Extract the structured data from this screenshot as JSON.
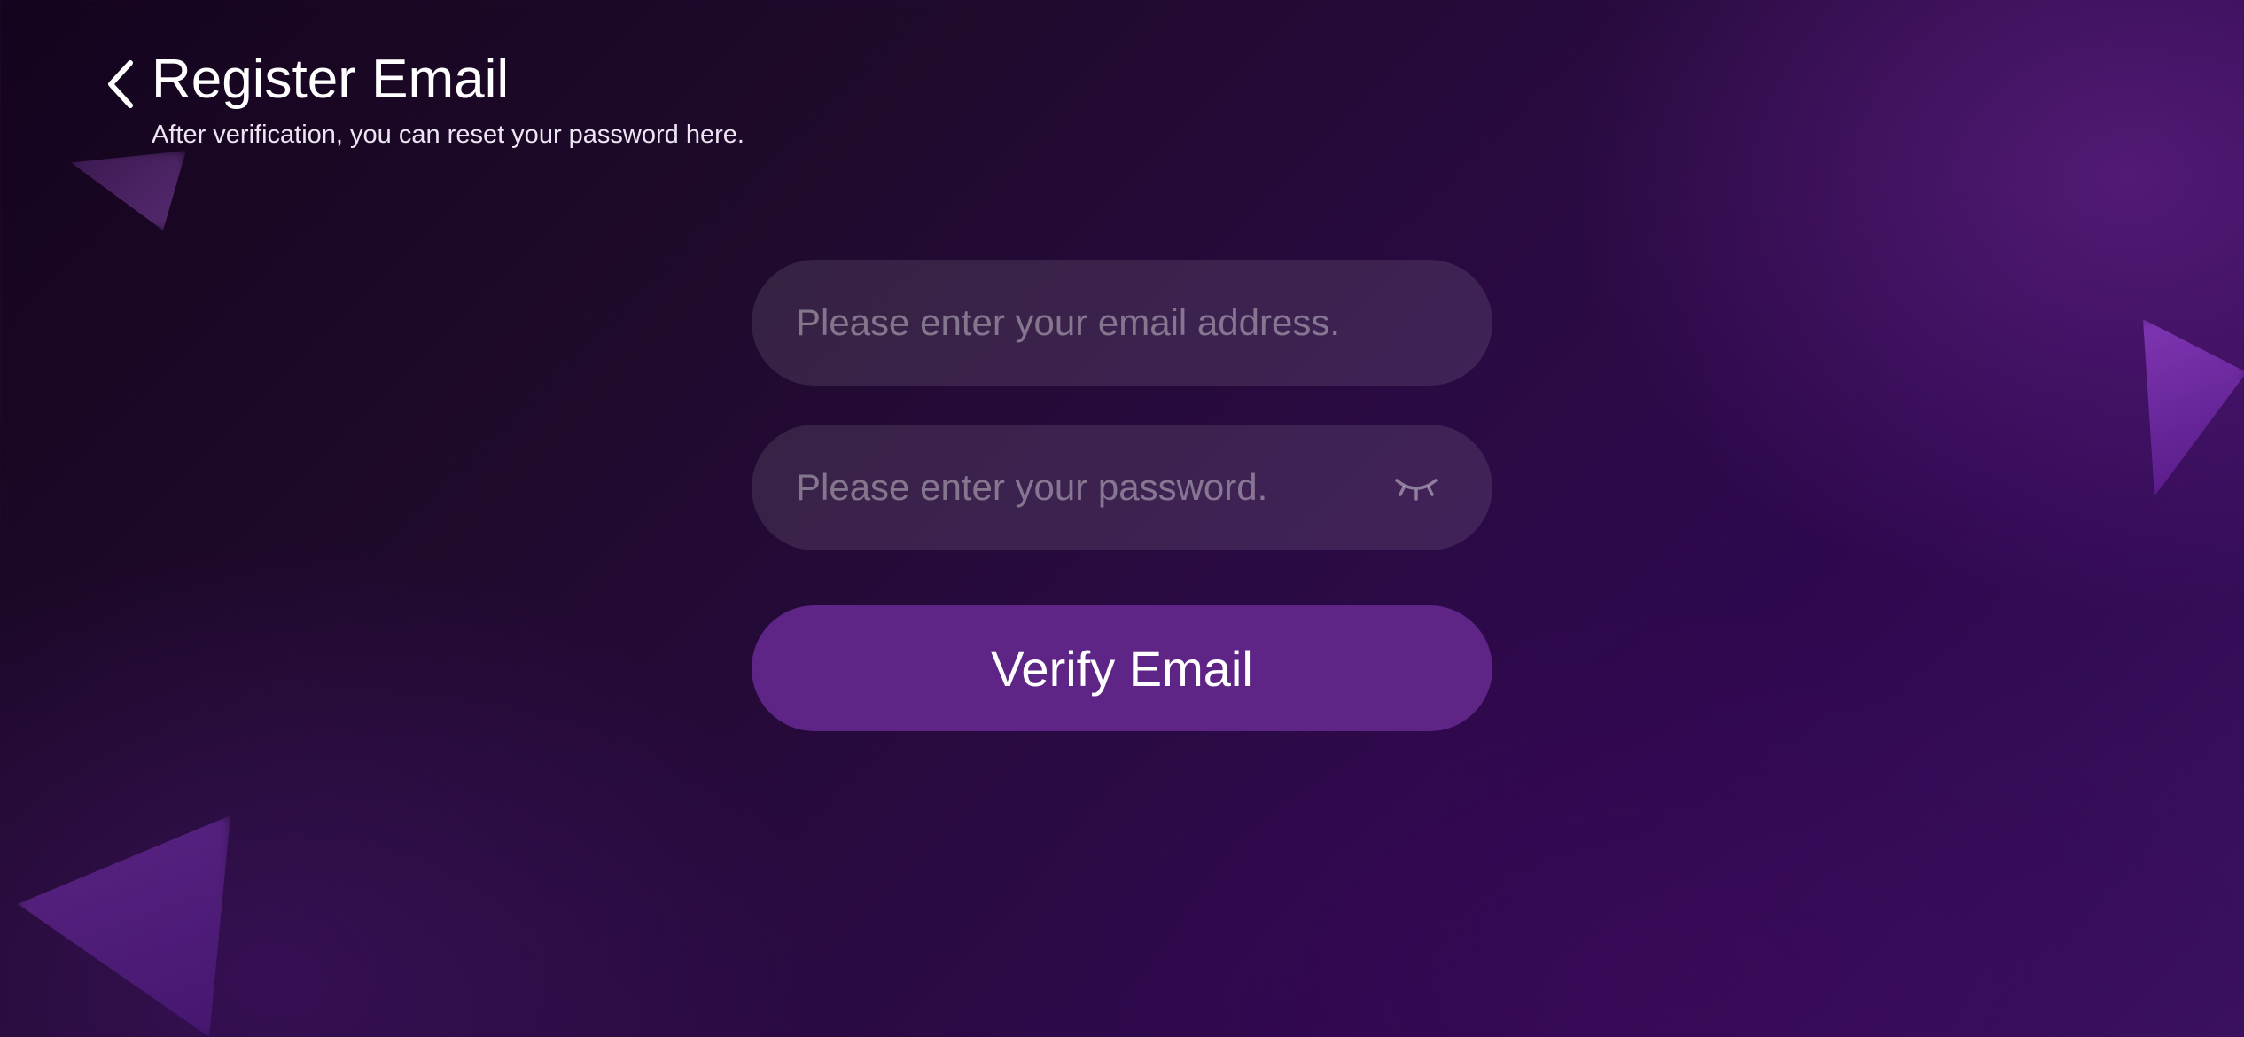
{
  "header": {
    "back_icon": "chevron-left-icon",
    "title": "Register Email",
    "subtitle": "After verification, you can reset your password here."
  },
  "form": {
    "email": {
      "value": "",
      "placeholder": "Please enter your email address."
    },
    "password": {
      "value": "",
      "placeholder": "Please enter your password.",
      "toggle_icon": "eye-closed-icon"
    },
    "submit_label": "Verify Email"
  },
  "colors": {
    "accent": "#5e2486",
    "background_dark": "#14041d",
    "background_purple": "#2f0850"
  }
}
